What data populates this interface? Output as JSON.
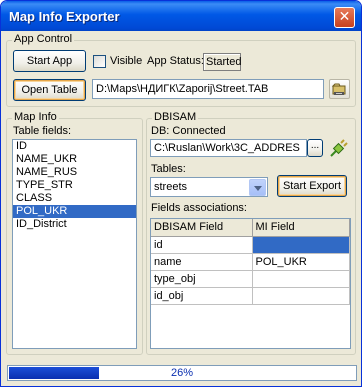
{
  "window": {
    "title": "Map Info Exporter",
    "close_glyph": "✕"
  },
  "app_control": {
    "group_label": "App Control",
    "start_button": "Start App",
    "visible_checkbox_label": "Visible",
    "visible_checked": false,
    "app_status_label": "App Status:",
    "app_status_value": "Started",
    "open_table_button": "Open Table",
    "table_path": "D:\\Maps\\НДИГК\\Zaporij\\Street.TAB",
    "browse_icon": "open-folder-icon"
  },
  "map_info": {
    "group_label": "Map Info",
    "table_fields_label": "Table fields:",
    "fields": [
      "ID",
      "NAME_UKR",
      "NAME_RUS",
      "TYPE_STR",
      "CLASS",
      "POL_UKR",
      "ID_District"
    ],
    "selected_index": 5
  },
  "dbisam": {
    "group_label": "DBISAM",
    "db_status": "DB: Connected",
    "db_path": "C:\\Ruslan\\Work\\3C_ADDRES",
    "ellipsis_button": "...",
    "connect_icon": "plug-connect-icon",
    "tables_label": "Tables:",
    "selected_table": "streets",
    "start_export_button": "Start Export",
    "fields_assoc_label": "Fields associations:",
    "assoc_headers": [
      "DBISAM Field",
      "MI Field"
    ],
    "assoc_rows": [
      {
        "db": "id",
        "mi": ""
      },
      {
        "db": "name",
        "mi": "POL_UKR"
      },
      {
        "db": "type_obj",
        "mi": ""
      },
      {
        "db": "id_obj",
        "mi": ""
      }
    ]
  },
  "progress": {
    "value": 0.26,
    "text": "26%"
  },
  "colors": {
    "title_bar": "#0058e6",
    "selection": "#316ac5",
    "progress_fill": "#0a2fb0"
  }
}
